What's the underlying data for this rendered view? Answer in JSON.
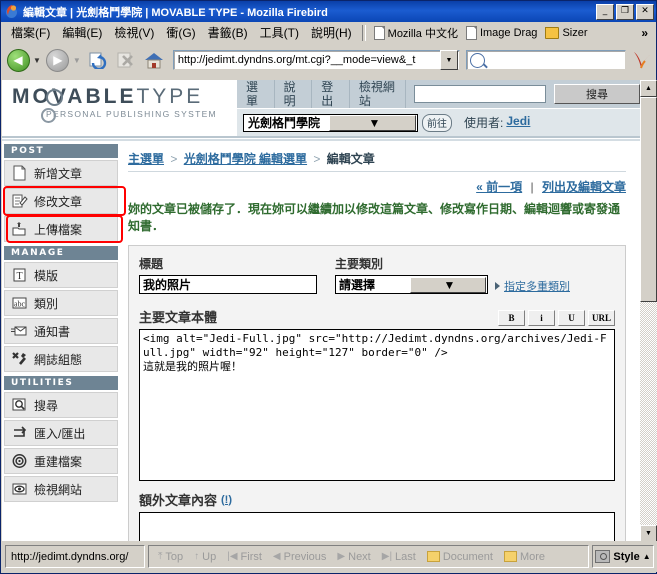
{
  "window": {
    "title": "編輯文章 | 光劍格鬥學院 | MOVABLE TYPE - Mozilla Firebird",
    "icon": "firebird-icon",
    "minimize": "_",
    "maximize": "❐",
    "close": "✕"
  },
  "menubar": {
    "items": [
      {
        "label": "檔案(F)"
      },
      {
        "label": "編輯(E)"
      },
      {
        "label": "檢視(V)"
      },
      {
        "label": "衝(G)"
      },
      {
        "label": "書籤(B)"
      },
      {
        "label": "工具(T)"
      },
      {
        "label": "說明(H)"
      }
    ],
    "bookmarks": [
      {
        "label": "Mozilla 中文化",
        "icon": "document-icon"
      },
      {
        "label": "Image Drag",
        "icon": "document-icon"
      },
      {
        "label": "Sizer",
        "icon": "folder-icon"
      }
    ],
    "overflow": "»"
  },
  "navbar": {
    "back": "back-button",
    "forward": "forward-button",
    "reload": "reload-button",
    "stop": "stop-button",
    "home": "home-button",
    "url": "http://jedimt.dyndns.org/mt.cgi?__mode=view&_t",
    "url_placeholder": "網址",
    "search_placeholder": "",
    "search_value": ""
  },
  "mt": {
    "logo_line1_bold": "M",
    "logo_line1": "OVABLE",
    "logo_line1_light": "TYPE",
    "logo_line2": "PERSONAL PUBLISHING SYSTEM",
    "menu": [
      {
        "label": "選單"
      },
      {
        "label": "說明"
      },
      {
        "label": "登出"
      },
      {
        "label": "檢視網站"
      }
    ],
    "search_value": "",
    "search_button": "搜尋",
    "blog_selected": "光劍格鬥學院",
    "go_button": "前往",
    "user_label": "使用者:",
    "user_name": "Jedi"
  },
  "sidebar": {
    "sections": [
      {
        "heading": "POST",
        "items": [
          {
            "label": "新增文章",
            "icon": "new-post-icon",
            "highlighted": false
          },
          {
            "label": "修改文章",
            "icon": "edit-post-icon",
            "highlighted": false
          },
          {
            "label": "上傳檔案",
            "icon": "upload-file-icon",
            "highlighted": true
          }
        ]
      },
      {
        "heading": "MANAGE",
        "items": [
          {
            "label": "模版",
            "icon": "template-icon",
            "highlighted": false
          },
          {
            "label": "類別",
            "icon": "category-icon",
            "highlighted": false
          },
          {
            "label": "通知書",
            "icon": "notification-icon",
            "highlighted": false
          },
          {
            "label": "網誌組態",
            "icon": "blog-config-icon",
            "highlighted": false
          }
        ]
      },
      {
        "heading": "UTILITIES",
        "items": [
          {
            "label": "搜尋",
            "icon": "search-icon",
            "highlighted": false
          },
          {
            "label": "匯入/匯出",
            "icon": "import-export-icon",
            "highlighted": false
          },
          {
            "label": "重建檔案",
            "icon": "rebuild-icon",
            "highlighted": false
          },
          {
            "label": "檢視網站",
            "icon": "view-site-icon",
            "highlighted": false
          }
        ]
      }
    ]
  },
  "main": {
    "breadcrumb": {
      "root": "主選單",
      "sep1": ">",
      "blog": "光劍格鬥學院 編輯選單",
      "sep2": ">",
      "current": "編輯文章"
    },
    "toplinks": {
      "prev": "« 前一項",
      "divider": "|",
      "list": "列出及編輯文章"
    },
    "message": "妳的文章已被儲存了．現在妳可以繼續加以修改這篇文章、修改寫作日期、編輯迴響或寄發通知書．",
    "fields": {
      "title_label": "標題",
      "title_value": "我的照片",
      "category_label": "主要類別",
      "category_value": "請選擇",
      "multi_category_link": "指定多重類別",
      "body_label": "主要文章本體",
      "format_buttons": [
        "B",
        "i",
        "U",
        "URL"
      ],
      "body_value": "<img alt=\"Jedi-Full.jpg\" src=\"http://Jedimt.dyndns.org/archives/Jedi-Full.jpg\" width=\"92\" height=\"127\" border=\"0\" />\n這就是我的照片喔！",
      "extended_label": "額外文章內容",
      "extended_help": "(!)",
      "extended_value": ""
    }
  },
  "statusbar": {
    "url": "http://jedimt.dyndns.org/",
    "nav": [
      {
        "label": "Top",
        "icon": "top-icon"
      },
      {
        "label": "Up",
        "icon": "up-icon"
      },
      {
        "label": "First",
        "icon": "first-icon"
      },
      {
        "label": "Previous",
        "icon": "previous-icon"
      },
      {
        "label": "Next",
        "icon": "next-icon"
      },
      {
        "label": "Last",
        "icon": "last-icon"
      },
      {
        "label": "Document",
        "icon": "folder-icon"
      },
      {
        "label": "More",
        "icon": "folder-icon"
      }
    ],
    "style_label": "Style",
    "style_arrow": "▲"
  },
  "colors": {
    "titlebar": "#0a46b5",
    "mt_header": "#c3ced6",
    "section_heading": "#6e8494",
    "highlight": "#ff0000",
    "link": "#2d6b9e",
    "message": "#2f6b2f"
  }
}
